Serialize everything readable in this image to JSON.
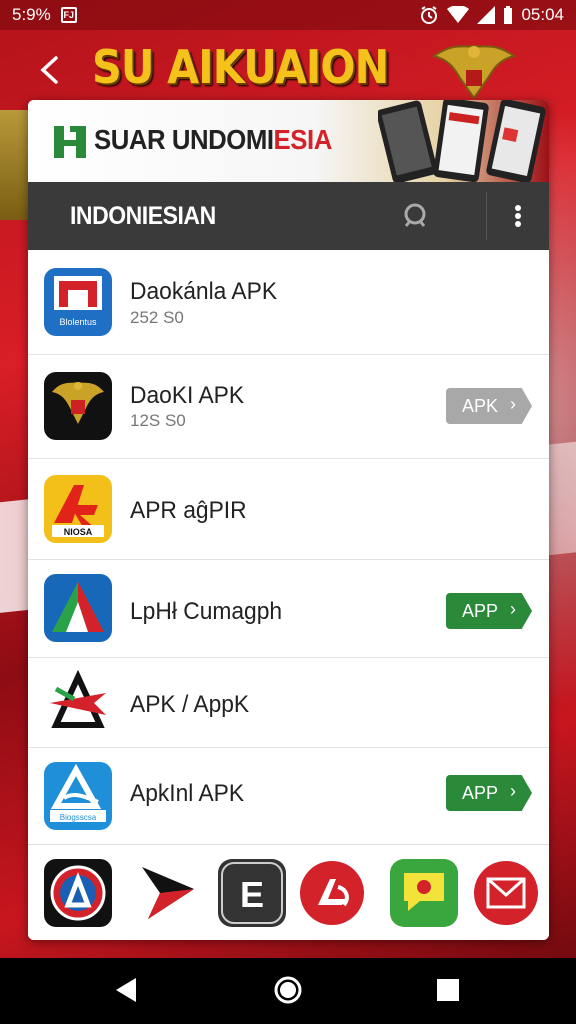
{
  "status_bar": {
    "left_value": "5:9%",
    "time": "05:04"
  },
  "header": {
    "title": "SU AIKUAION"
  },
  "banner": {
    "text_dark": "SUAR UNDOMI",
    "text_red": "ESIA"
  },
  "toolbar": {
    "title": "INDONIESIAN"
  },
  "apps": [
    {
      "title": "Daokánla APK",
      "subtitle": "252 S0",
      "button": "",
      "icon_name": "daokanla-app-icon",
      "icon_label": "Blolentus"
    },
    {
      "title": "DaoKI APK",
      "subtitle": "12S S0",
      "button": "APK",
      "button_style": "grey",
      "icon_name": "garuda-app-icon"
    },
    {
      "title": "APR aĝPIR",
      "subtitle": "",
      "button": "",
      "icon_name": "apr-app-icon",
      "icon_label": "NIOSA"
    },
    {
      "title": "LpHł Cumagph",
      "subtitle": "",
      "button": "APP",
      "button_style": "green",
      "icon_name": "triangle-app-icon"
    },
    {
      "title": "APK / AppK",
      "subtitle": "",
      "button": "",
      "icon_name": "apk-star-app-icon"
    },
    {
      "title": "ApkInl APK",
      "subtitle": "",
      "button": "APP",
      "button_style": "green",
      "icon_name": "apkinl-app-icon",
      "icon_label": "Biogsscsa"
    }
  ],
  "dock": [
    {
      "name": "dock-a-app-icon"
    },
    {
      "name": "dock-arrow-app-icon"
    },
    {
      "name": "dock-e-app-icon",
      "letter": "E"
    },
    {
      "name": "dock-red-a-app-icon"
    },
    {
      "name": "dock-chat-app-icon"
    },
    {
      "name": "dock-mail-app-icon"
    }
  ],
  "colors": {
    "accent_gold": "#f4c21b",
    "toolbar": "#3a3a3a",
    "button_green": "#2a8a3a",
    "button_grey": "#a8a8a8",
    "brand_red": "#d3222a"
  }
}
